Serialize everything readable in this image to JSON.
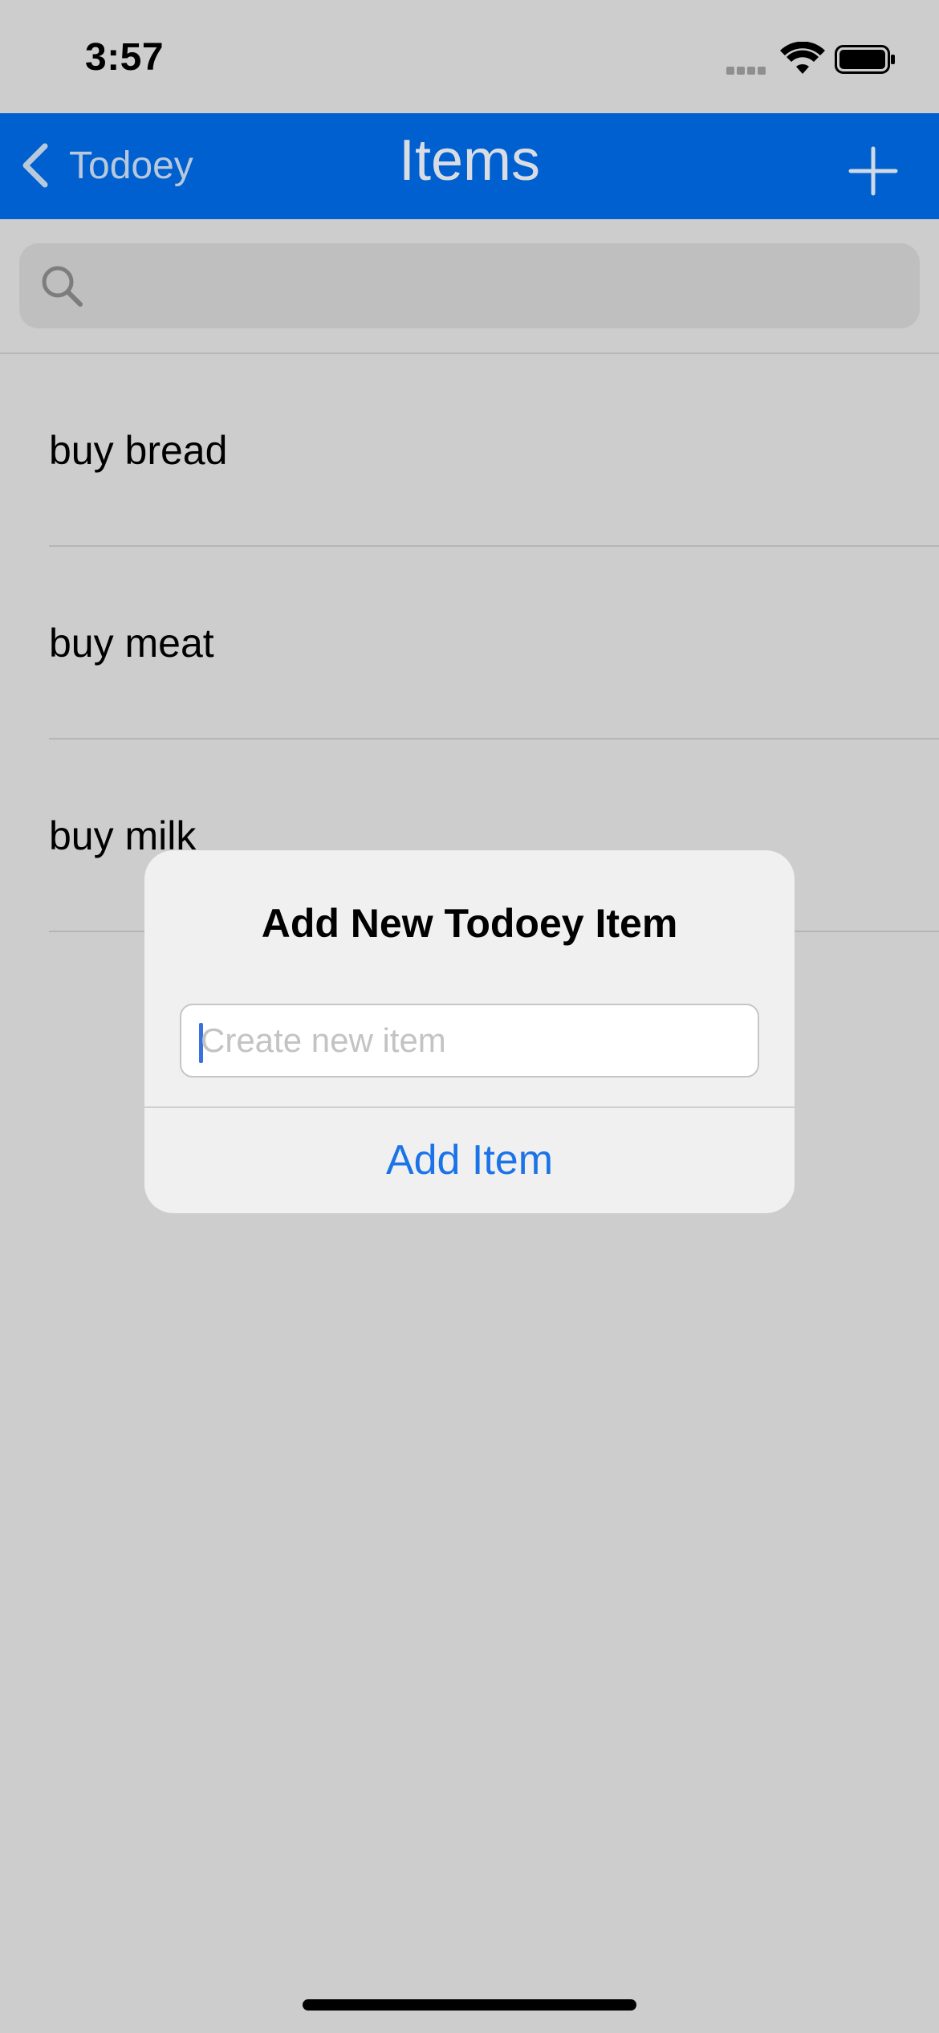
{
  "status_bar": {
    "time": "3:57",
    "icons": [
      "signal-icon",
      "wifi-icon",
      "battery-icon"
    ]
  },
  "nav": {
    "back_label": "Todoey",
    "title": "Items",
    "add_icon": "plus-icon",
    "bar_color": "#0060cf"
  },
  "search": {
    "placeholder": "",
    "icon": "search-icon"
  },
  "items": [
    {
      "label": "buy bread"
    },
    {
      "label": "buy meat"
    },
    {
      "label": "buy milk"
    }
  ],
  "alert": {
    "title": "Add New Todoey Item",
    "field_placeholder": "Create new item",
    "field_value": "",
    "action_label": "Add Item",
    "action_color": "#1a73e8"
  }
}
